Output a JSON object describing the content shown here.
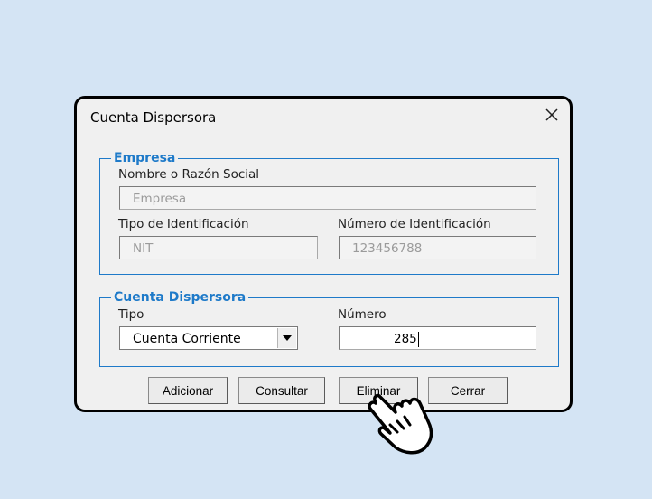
{
  "dialog": {
    "title": "Cuenta Dispersora",
    "icons": {
      "close": "close-icon",
      "dropdown": "chevron-down-icon",
      "cursor": "pointing-hand-icon"
    }
  },
  "empresa": {
    "legend": "Empresa",
    "name_label": "Nombre o Razón Social",
    "name_placeholder": "Empresa",
    "id_type_label": "Tipo de Identificación",
    "id_type_value": "NIT",
    "id_number_label": "Número  de Identificación",
    "id_number_value": "123456788"
  },
  "cuenta": {
    "legend": "Cuenta Dispersora",
    "type_label": "Tipo",
    "type_value": "Cuenta Corriente",
    "number_label": "Número",
    "number_value": "285"
  },
  "buttons": {
    "add": "Adicionar",
    "query": "Consultar",
    "delete": "Eliminar",
    "close": "Cerrar"
  },
  "colors": {
    "background": "#d4e4f4",
    "dialog": "#f0f0f0",
    "accent": "#1e7ac9"
  }
}
